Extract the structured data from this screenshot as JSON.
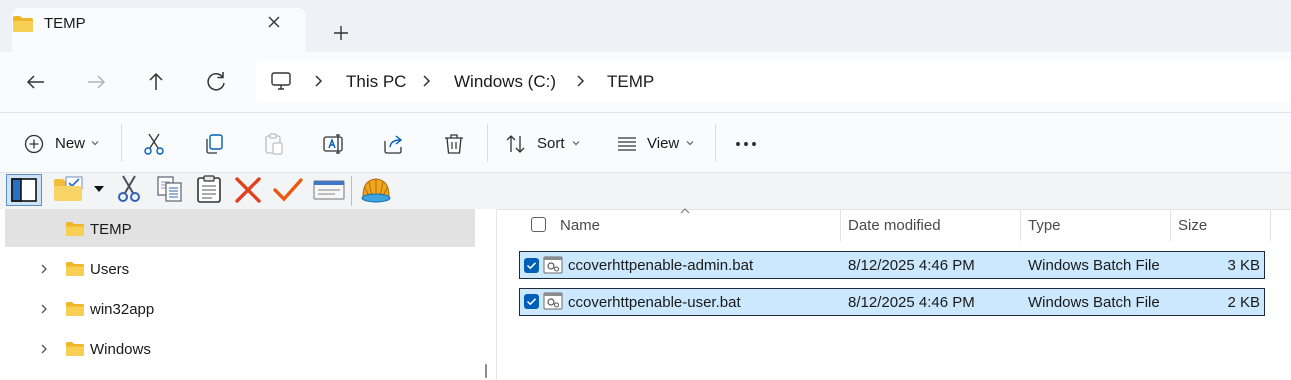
{
  "tab": {
    "title": "TEMP"
  },
  "address": {
    "crumbs": [
      "This PC",
      "Windows (C:)",
      "TEMP"
    ]
  },
  "commands": {
    "new_label": "New",
    "sort_label": "Sort",
    "view_label": "View"
  },
  "nav_pane": {
    "items": [
      "TEMP",
      "Users",
      "win32app",
      "Windows"
    ]
  },
  "file_list": {
    "columns": [
      "Name",
      "Date modified",
      "Type",
      "Size"
    ],
    "rows": [
      {
        "name": "ccoverhttpenable-admin.bat",
        "date": "8/12/2025 4:46 PM",
        "type": "Windows Batch File",
        "size": "3 KB"
      },
      {
        "name": "ccoverhttpenable-user.bat",
        "date": "8/12/2025 4:46 PM",
        "type": "Windows Batch File",
        "size": "2 KB"
      }
    ]
  },
  "colors": {
    "accent": "#005fb8",
    "selection": "#cce8ff",
    "folder": "#f4c542"
  }
}
